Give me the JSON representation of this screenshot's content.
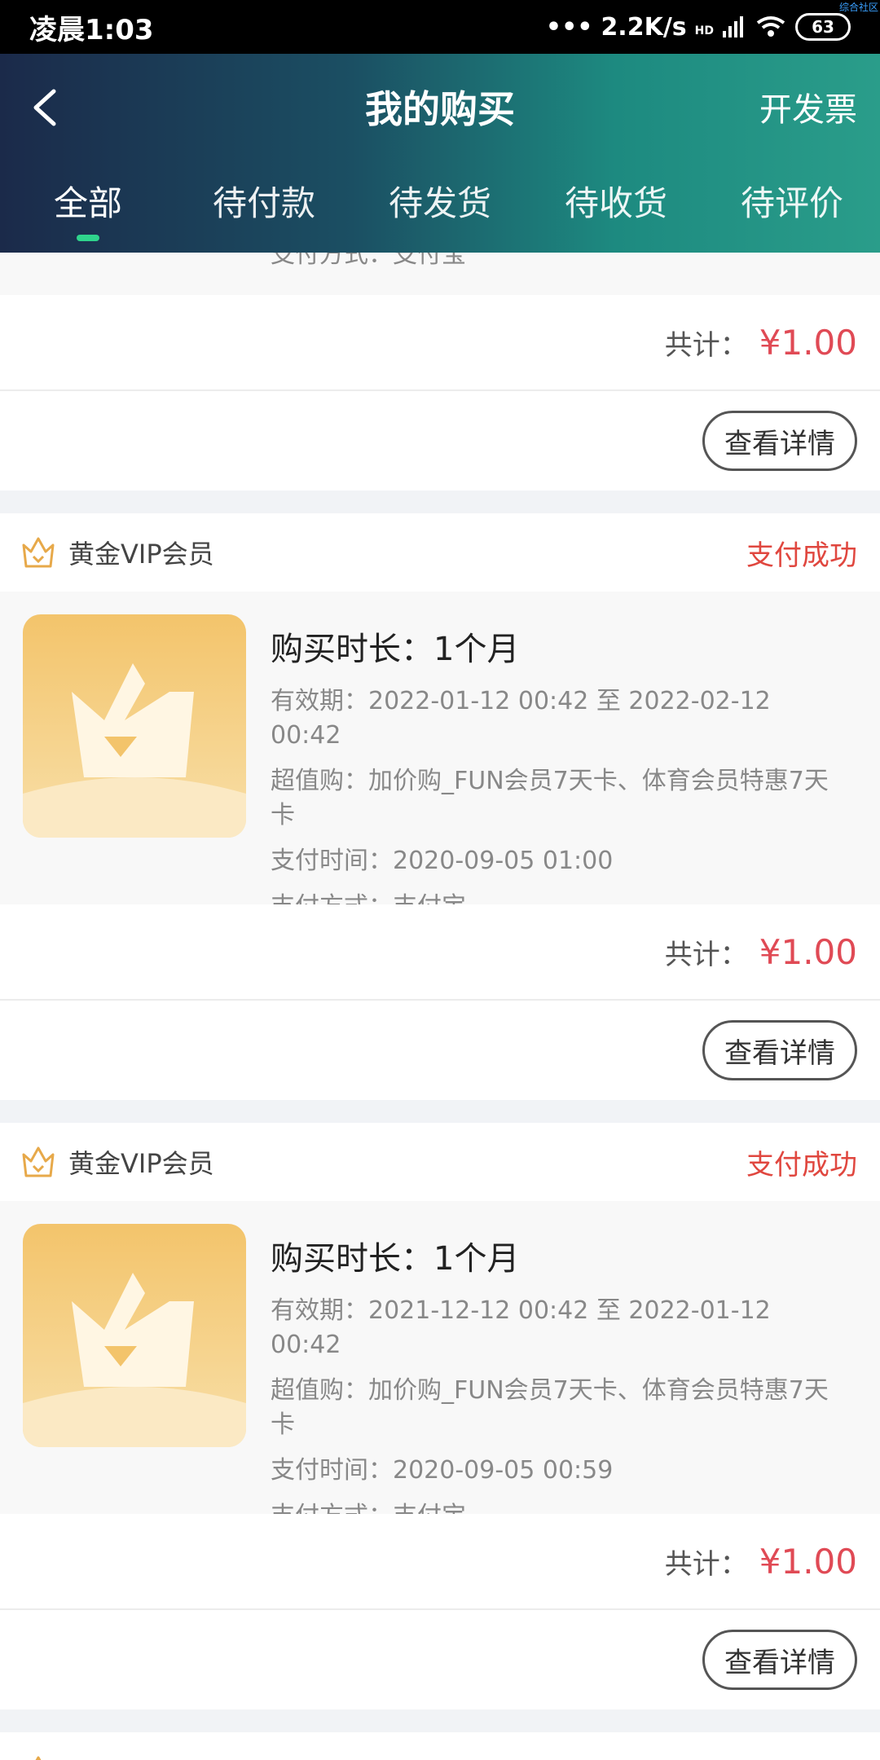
{
  "status_bar": {
    "time": "凌晨1:03",
    "network_speed": "2.2K/s",
    "hd_badge": "HD",
    "battery": "63",
    "corner_mark": "综合社区"
  },
  "header": {
    "title": "我的购买",
    "invoice_label": "开发票",
    "accent_color": "#2fd48c"
  },
  "tabs": [
    {
      "label": "全部",
      "active": true
    },
    {
      "label": "待付款",
      "active": false
    },
    {
      "label": "待发货",
      "active": false
    },
    {
      "label": "待收货",
      "active": false
    },
    {
      "label": "待评价",
      "active": false
    }
  ],
  "partial_order": {
    "payment_method": "支付方式：支付宝",
    "total_label": "共计：",
    "total_value": "¥1.00",
    "detail_label": "查看详情"
  },
  "orders": [
    {
      "name": "黄金VIP会员",
      "status": "支付成功",
      "title": "购买时长：1个月",
      "validity": "有效期：2022-01-12 00:42 至 2022-02-12 00:42",
      "bonus": "超值购：加价购_FUN会员7天卡、体育会员特惠7天卡",
      "pay_time": "支付时间：2020-09-05 01:00",
      "pay_method": "支付方式：支付宝",
      "total_label": "共计：",
      "total_value": "¥1.00",
      "detail_label": "查看详情"
    },
    {
      "name": "黄金VIP会员",
      "status": "支付成功",
      "title": "购买时长：1个月",
      "validity": "有效期：2021-12-12 00:42 至 2022-01-12 00:42",
      "bonus": "超值购：加价购_FUN会员7天卡、体育会员特惠7天卡",
      "pay_time": "支付时间：2020-09-05 00:59",
      "pay_method": "支付方式：支付宝",
      "total_label": "共计：",
      "total_value": "¥1.00",
      "detail_label": "查看详情"
    }
  ]
}
